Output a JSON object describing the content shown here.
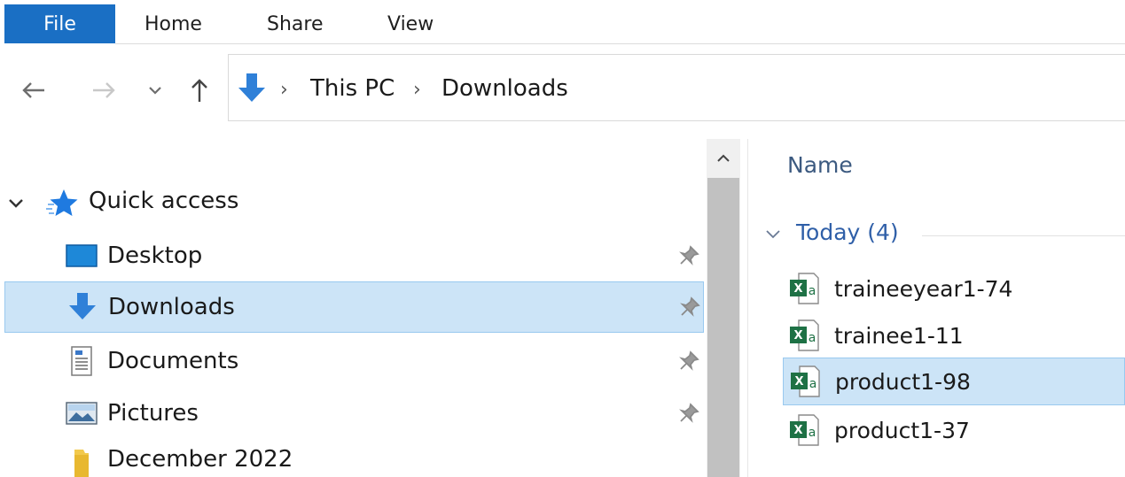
{
  "ribbon": {
    "tabs": [
      "File",
      "Home",
      "Share",
      "View"
    ]
  },
  "nav": {
    "back_icon": "back-arrow-icon",
    "forward_icon": "forward-arrow-icon",
    "recent_icon": "chevron-down-icon",
    "up_icon": "up-arrow-icon"
  },
  "address": {
    "breadcrumbs": [
      "This PC",
      "Downloads"
    ]
  },
  "sidebar": {
    "section": "Quick access",
    "items": [
      {
        "label": "Desktop",
        "icon": "desktop-icon",
        "pinned": true
      },
      {
        "label": "Downloads",
        "icon": "downloads-icon",
        "pinned": true,
        "selected": true
      },
      {
        "label": "Documents",
        "icon": "documents-icon",
        "pinned": true
      },
      {
        "label": "Pictures",
        "icon": "pictures-icon",
        "pinned": true
      },
      {
        "label": "December 2022",
        "icon": "folder-icon",
        "pinned": false
      }
    ]
  },
  "content": {
    "column_name": "Name",
    "group": {
      "label": "Today (4)"
    },
    "files": [
      {
        "name": "traineeyear1-74",
        "icon": "excel-file-icon"
      },
      {
        "name": "trainee1-11",
        "icon": "excel-file-icon"
      },
      {
        "name": "product1-98",
        "icon": "excel-file-icon",
        "selected": true
      },
      {
        "name": "product1-37",
        "icon": "excel-file-icon"
      }
    ]
  },
  "colors": {
    "accent": "#1a6fc4",
    "selection": "#cce4f7",
    "selection_border": "#99c9ef",
    "group_text": "#2f5fa8"
  }
}
